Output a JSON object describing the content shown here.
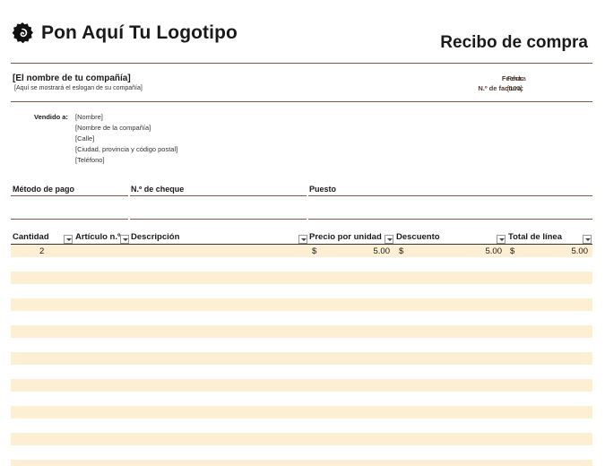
{
  "header": {
    "logo_text": "Pon Aquí Tu Logotipo",
    "doc_title": "Recibo de compra"
  },
  "company": {
    "name": "[El nombre de tu compañía]",
    "slogan": "[Aquí se mostrará el eslogan de su compañía]"
  },
  "meta": {
    "date_label": "Fecha:",
    "date_value": "Fecha",
    "invoice_label": "N.º de factura:",
    "invoice_value": "[100]"
  },
  "sold_to": {
    "label": "Vendido a:",
    "lines": [
      "[Nombre]",
      "[Nombre de la compañía]",
      "[Calle]",
      "[Ciudad, provincia y código postal]",
      "[Teléfono]"
    ]
  },
  "payment": {
    "method_label": "Método de pago",
    "check_label": "N.º de cheque",
    "job_label": "Puesto"
  },
  "table": {
    "headers": [
      "Cantidad",
      "Artículo n.º",
      "Descripción",
      "Precio por unidad",
      "Descuento",
      "Total de línea"
    ],
    "rows": [
      {
        "qty": "2",
        "item": "",
        "desc": "",
        "price_symbol": "$",
        "price": "5.00",
        "disc_symbol": "$",
        "disc": "5.00",
        "total_symbol": "$",
        "total": "5.00"
      }
    ]
  },
  "colors": {
    "rule": "#7a5a4a",
    "band": "#fcefd4"
  }
}
